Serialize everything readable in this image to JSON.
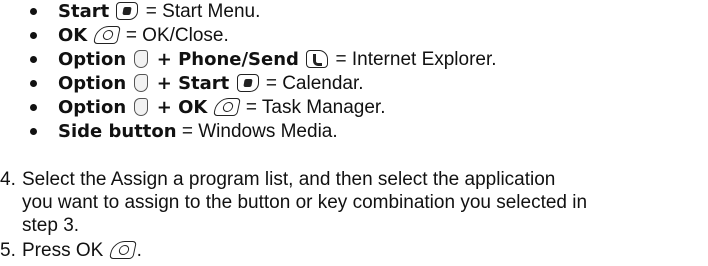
{
  "bullets": [
    {
      "bold": "Start",
      "icon": "start-key-icon",
      "text": " = Start Menu."
    },
    {
      "bold": "OK",
      "icon": "ok-key-icon",
      "text": " = OK/Close."
    },
    {
      "bold1": "Option",
      "icon1": "option-key-icon",
      "bold2": " + Phone/Send",
      "icon2": "phone-send-key-icon",
      "text": " = Internet Explorer."
    },
    {
      "bold1": "Option",
      "icon1": "option-key-icon",
      "bold2": " + Start",
      "icon2": "start-key-icon",
      "text": " = Calendar."
    },
    {
      "bold1": "Option",
      "icon1": "option-key-icon",
      "bold2": " + OK",
      "icon2": "ok-key-icon",
      "text": " = Task Manager."
    },
    {
      "bold": "Side button",
      "text": " = Windows Media."
    }
  ],
  "steps": [
    {
      "number": "4.",
      "line1": "Select the Assign a program list, and then select the application",
      "line2": "you want to assign to the button or key combination you selected in",
      "line3": "step 3."
    },
    {
      "number": "5.",
      "text": "Press OK",
      "end": ".",
      "icon": "ok-key-icon"
    }
  ]
}
